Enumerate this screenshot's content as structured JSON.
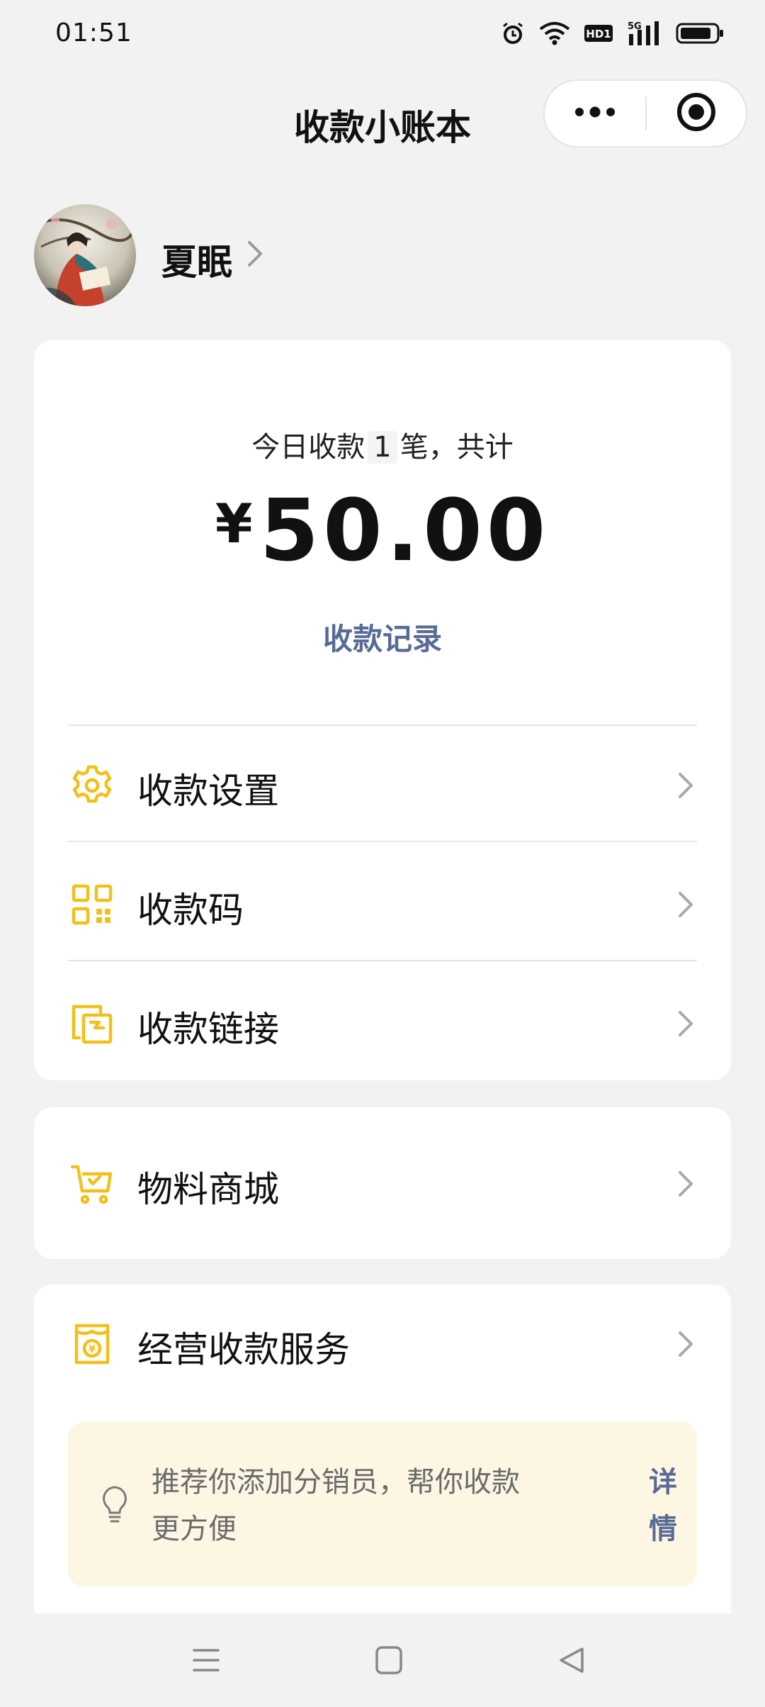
{
  "status_bar": {
    "time": "01:51",
    "icons": [
      "alarm-icon",
      "wifi-icon",
      "hd-icon",
      "5g-signal-icon",
      "battery-icon"
    ],
    "hd_label": "HD1",
    "network_label": "5G"
  },
  "header": {
    "title": "收款小账本",
    "capsule": {
      "more_icon": "more-dots-icon",
      "close_icon": "target-circle-icon"
    }
  },
  "profile": {
    "name": "夏眠"
  },
  "summary": {
    "today_prefix": "今日收款",
    "count": "1",
    "today_suffix": "笔，共计",
    "currency": "¥",
    "amount": "50.00",
    "records_link": "收款记录"
  },
  "menu": [
    {
      "label": "收款设置",
      "icon": "gear-icon"
    },
    {
      "label": "收款码",
      "icon": "qr-code-icon"
    },
    {
      "label": "收款链接",
      "icon": "link-icon"
    }
  ],
  "store": {
    "label": "物料商城",
    "icon": "cart-icon"
  },
  "service": {
    "label": "经营收款服务",
    "icon": "shop-bag-icon",
    "tip_text": "推荐你添加分销员，帮你收款更方便",
    "tip_link": "详情",
    "tip_icon": "lightbulb-icon"
  },
  "colors": {
    "accent_yellow": "#f2c01d",
    "link_blue": "#576b95",
    "tip_background": "#fdf6e3",
    "page_background": "#f2f2f2"
  }
}
